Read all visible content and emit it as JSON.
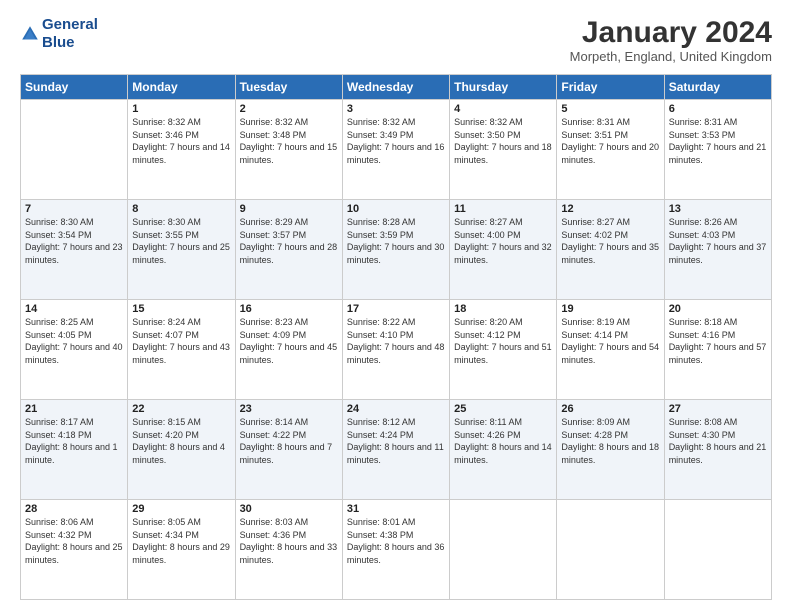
{
  "header": {
    "logo_line1": "General",
    "logo_line2": "Blue",
    "title": "January 2024",
    "subtitle": "Morpeth, England, United Kingdom"
  },
  "weekdays": [
    "Sunday",
    "Monday",
    "Tuesday",
    "Wednesday",
    "Thursday",
    "Friday",
    "Saturday"
  ],
  "weeks": [
    [
      {
        "day": "",
        "sunrise": "",
        "sunset": "",
        "daylight": ""
      },
      {
        "day": "1",
        "sunrise": "8:32 AM",
        "sunset": "3:46 PM",
        "daylight": "7 hours and 14 minutes."
      },
      {
        "day": "2",
        "sunrise": "8:32 AM",
        "sunset": "3:48 PM",
        "daylight": "7 hours and 15 minutes."
      },
      {
        "day": "3",
        "sunrise": "8:32 AM",
        "sunset": "3:49 PM",
        "daylight": "7 hours and 16 minutes."
      },
      {
        "day": "4",
        "sunrise": "8:32 AM",
        "sunset": "3:50 PM",
        "daylight": "7 hours and 18 minutes."
      },
      {
        "day": "5",
        "sunrise": "8:31 AM",
        "sunset": "3:51 PM",
        "daylight": "7 hours and 20 minutes."
      },
      {
        "day": "6",
        "sunrise": "8:31 AM",
        "sunset": "3:53 PM",
        "daylight": "7 hours and 21 minutes."
      }
    ],
    [
      {
        "day": "7",
        "sunrise": "8:30 AM",
        "sunset": "3:54 PM",
        "daylight": "7 hours and 23 minutes."
      },
      {
        "day": "8",
        "sunrise": "8:30 AM",
        "sunset": "3:55 PM",
        "daylight": "7 hours and 25 minutes."
      },
      {
        "day": "9",
        "sunrise": "8:29 AM",
        "sunset": "3:57 PM",
        "daylight": "7 hours and 28 minutes."
      },
      {
        "day": "10",
        "sunrise": "8:28 AM",
        "sunset": "3:59 PM",
        "daylight": "7 hours and 30 minutes."
      },
      {
        "day": "11",
        "sunrise": "8:27 AM",
        "sunset": "4:00 PM",
        "daylight": "7 hours and 32 minutes."
      },
      {
        "day": "12",
        "sunrise": "8:27 AM",
        "sunset": "4:02 PM",
        "daylight": "7 hours and 35 minutes."
      },
      {
        "day": "13",
        "sunrise": "8:26 AM",
        "sunset": "4:03 PM",
        "daylight": "7 hours and 37 minutes."
      }
    ],
    [
      {
        "day": "14",
        "sunrise": "8:25 AM",
        "sunset": "4:05 PM",
        "daylight": "7 hours and 40 minutes."
      },
      {
        "day": "15",
        "sunrise": "8:24 AM",
        "sunset": "4:07 PM",
        "daylight": "7 hours and 43 minutes."
      },
      {
        "day": "16",
        "sunrise": "8:23 AM",
        "sunset": "4:09 PM",
        "daylight": "7 hours and 45 minutes."
      },
      {
        "day": "17",
        "sunrise": "8:22 AM",
        "sunset": "4:10 PM",
        "daylight": "7 hours and 48 minutes."
      },
      {
        "day": "18",
        "sunrise": "8:20 AM",
        "sunset": "4:12 PM",
        "daylight": "7 hours and 51 minutes."
      },
      {
        "day": "19",
        "sunrise": "8:19 AM",
        "sunset": "4:14 PM",
        "daylight": "7 hours and 54 minutes."
      },
      {
        "day": "20",
        "sunrise": "8:18 AM",
        "sunset": "4:16 PM",
        "daylight": "7 hours and 57 minutes."
      }
    ],
    [
      {
        "day": "21",
        "sunrise": "8:17 AM",
        "sunset": "4:18 PM",
        "daylight": "8 hours and 1 minute."
      },
      {
        "day": "22",
        "sunrise": "8:15 AM",
        "sunset": "4:20 PM",
        "daylight": "8 hours and 4 minutes."
      },
      {
        "day": "23",
        "sunrise": "8:14 AM",
        "sunset": "4:22 PM",
        "daylight": "8 hours and 7 minutes."
      },
      {
        "day": "24",
        "sunrise": "8:12 AM",
        "sunset": "4:24 PM",
        "daylight": "8 hours and 11 minutes."
      },
      {
        "day": "25",
        "sunrise": "8:11 AM",
        "sunset": "4:26 PM",
        "daylight": "8 hours and 14 minutes."
      },
      {
        "day": "26",
        "sunrise": "8:09 AM",
        "sunset": "4:28 PM",
        "daylight": "8 hours and 18 minutes."
      },
      {
        "day": "27",
        "sunrise": "8:08 AM",
        "sunset": "4:30 PM",
        "daylight": "8 hours and 21 minutes."
      }
    ],
    [
      {
        "day": "28",
        "sunrise": "8:06 AM",
        "sunset": "4:32 PM",
        "daylight": "8 hours and 25 minutes."
      },
      {
        "day": "29",
        "sunrise": "8:05 AM",
        "sunset": "4:34 PM",
        "daylight": "8 hours and 29 minutes."
      },
      {
        "day": "30",
        "sunrise": "8:03 AM",
        "sunset": "4:36 PM",
        "daylight": "8 hours and 33 minutes."
      },
      {
        "day": "31",
        "sunrise": "8:01 AM",
        "sunset": "4:38 PM",
        "daylight": "8 hours and 36 minutes."
      },
      {
        "day": "",
        "sunrise": "",
        "sunset": "",
        "daylight": ""
      },
      {
        "day": "",
        "sunrise": "",
        "sunset": "",
        "daylight": ""
      },
      {
        "day": "",
        "sunrise": "",
        "sunset": "",
        "daylight": ""
      }
    ]
  ],
  "labels": {
    "sunrise_prefix": "Sunrise: ",
    "sunset_prefix": "Sunset: ",
    "daylight_prefix": "Daylight: "
  }
}
